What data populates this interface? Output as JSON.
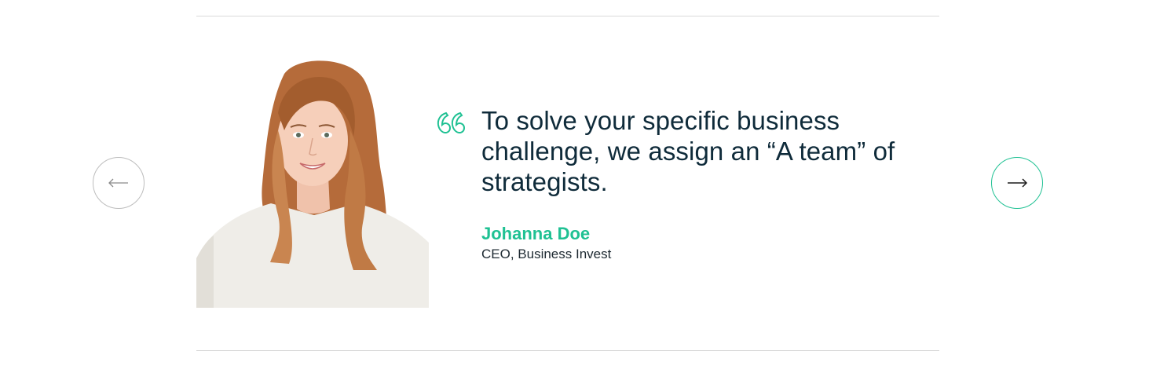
{
  "testimonial": {
    "quote": "To solve your specific business challenge, we assign an “A team” of strategists.",
    "author_name": "Johanna Doe",
    "author_role": "CEO, Business Invest",
    "quote_icon": "quote-icon"
  },
  "navigation": {
    "prev_icon": "arrow-left-icon",
    "next_icon": "arrow-right-icon"
  },
  "colors": {
    "accent": "#1fc193",
    "text_dark": "#0f2b3a",
    "divider": "#d9d9d9",
    "prev_border": "#bdbdbd"
  }
}
